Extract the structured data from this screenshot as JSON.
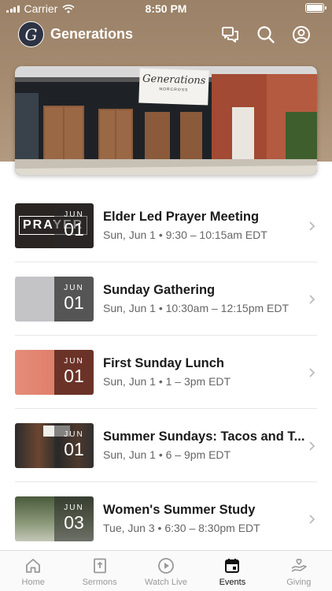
{
  "status": {
    "carrier": "Carrier",
    "time": "8:50 PM"
  },
  "app": {
    "title": "Generations",
    "logo_letter": "G"
  },
  "hero": {
    "banner_title": "Generations",
    "banner_sub": "NORCROSS"
  },
  "events": [
    {
      "title": "Elder Led Prayer Meeting",
      "subtitle": "Sun, Jun 1 • 9:30 – 10:15am EDT",
      "month": "JUN",
      "day": "01",
      "thumb_text": "PRAYER"
    },
    {
      "title": "Sunday Gathering",
      "subtitle": "Sun, Jun 1 • 10:30am – 12:15pm EDT",
      "month": "JUN",
      "day": "01"
    },
    {
      "title": "First Sunday Lunch",
      "subtitle": "Sun, Jun 1 • 1 – 3pm EDT",
      "month": "JUN",
      "day": "01"
    },
    {
      "title": "Summer Sundays: Tacos and T...",
      "subtitle": "Sun, Jun 1 • 6 – 9pm EDT",
      "month": "JUN",
      "day": "01"
    },
    {
      "title": "Women's Summer Study",
      "subtitle": "Tue, Jun 3 • 6:30 – 8:30pm EDT",
      "month": "JUN",
      "day": "03"
    }
  ],
  "tabs": [
    {
      "label": "Home",
      "icon": "home-icon"
    },
    {
      "label": "Sermons",
      "icon": "bible-icon"
    },
    {
      "label": "Watch Live",
      "icon": "play-icon"
    },
    {
      "label": "Events",
      "icon": "calendar-icon",
      "active": true
    },
    {
      "label": "Giving",
      "icon": "giving-icon"
    }
  ],
  "colors": {
    "header_bg": "#a88d72",
    "active_tab": "#111111",
    "inactive_tab": "#999999"
  }
}
